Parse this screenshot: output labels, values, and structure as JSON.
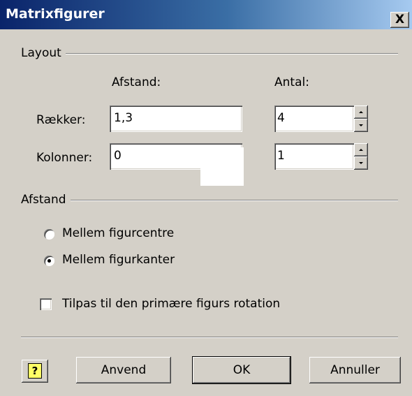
{
  "window": {
    "title": "Matrixfigurer",
    "close_label": "X"
  },
  "layout": {
    "group_label": "Layout",
    "col_spacing": "Afstand:",
    "col_count": "Antal:",
    "rows_label": "Rækker:",
    "rows_spacing_value": "1,3",
    "rows_count_value": "4",
    "cols_label": "Kolonner:",
    "cols_spacing_value": "0",
    "cols_count_value": "1"
  },
  "spacing": {
    "group_label": "Afstand",
    "option_centers": "Mellem figurcentre",
    "option_edges": "Mellem figurkanter",
    "selected": "Mellem figurkanter"
  },
  "rotation_checkbox": {
    "label": "Tilpas til den primære figurs rotation",
    "checked": false
  },
  "buttons": {
    "help": "?",
    "apply": "Anvend",
    "ok": "OK",
    "cancel": "Annuller"
  }
}
